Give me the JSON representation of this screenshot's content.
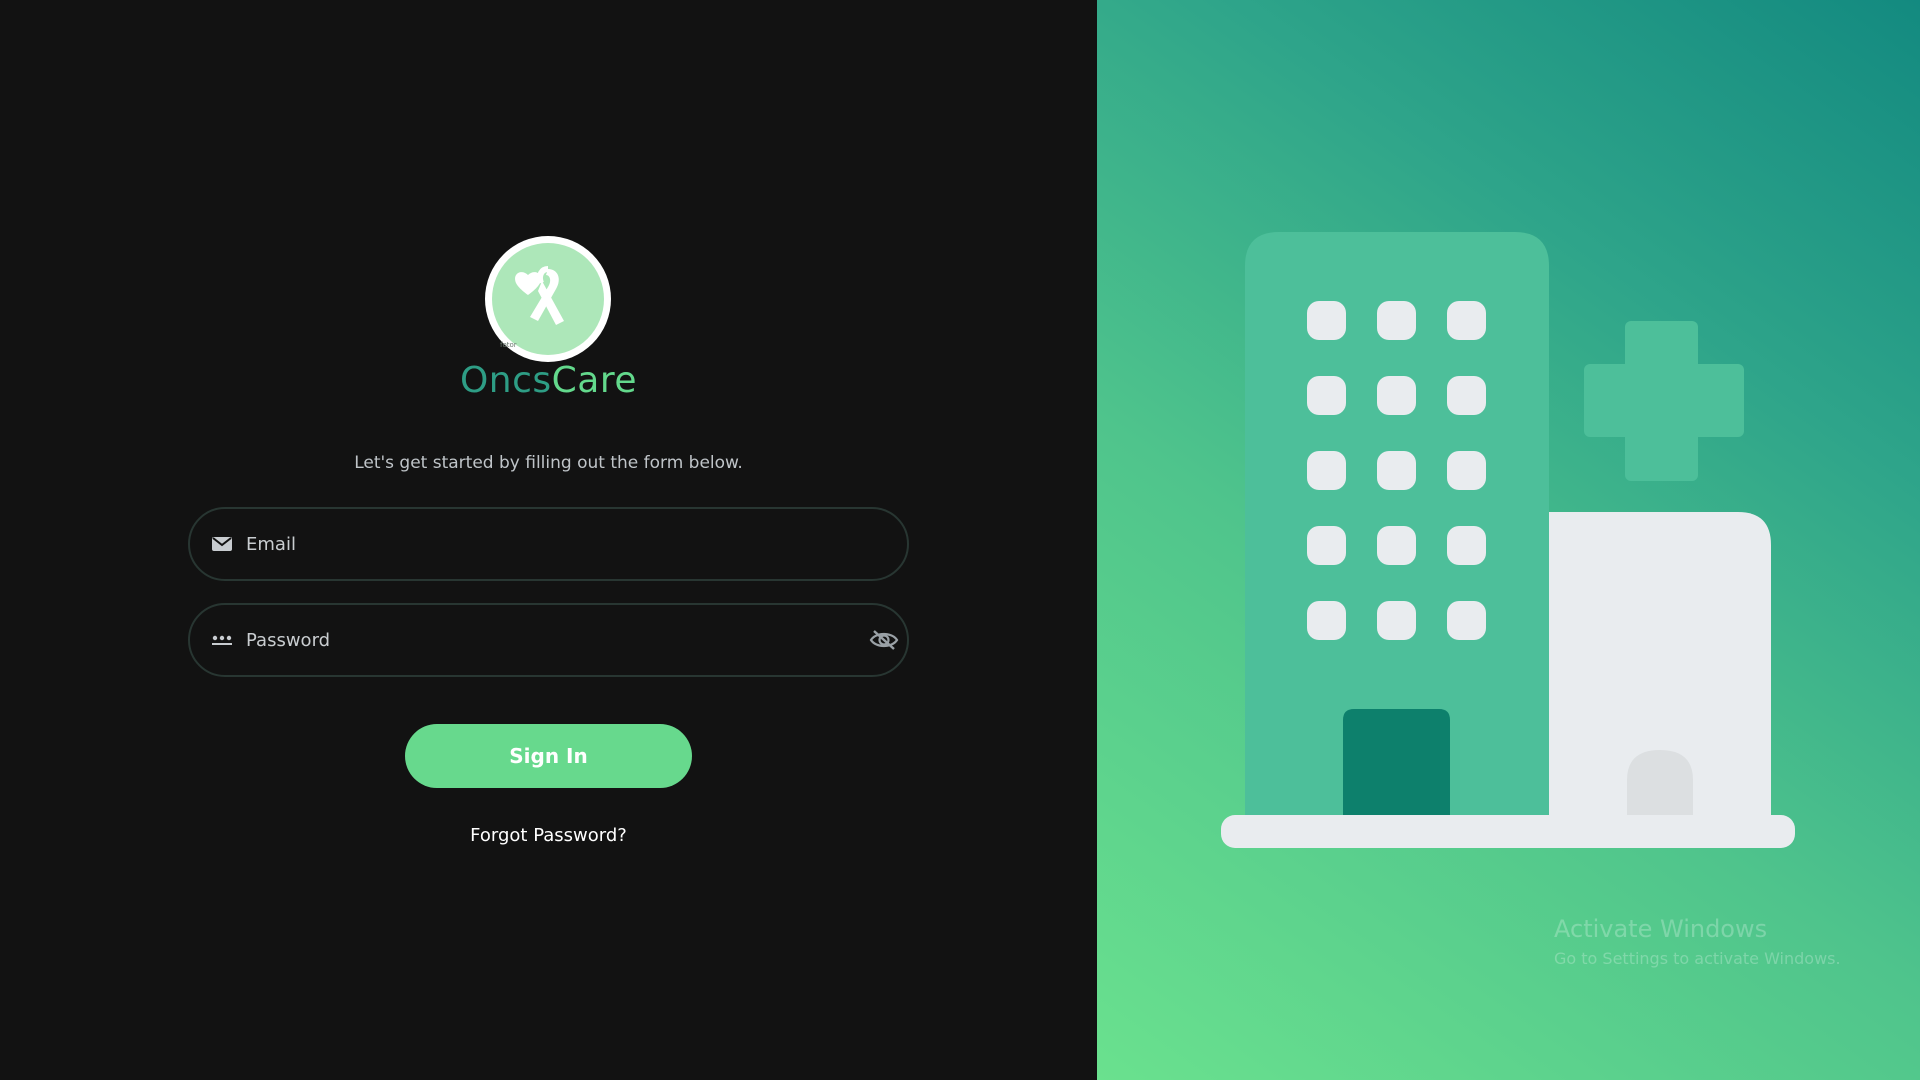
{
  "brand": {
    "logo_tag": "fotor",
    "name_part1": "Oncs",
    "name_part2": "Care"
  },
  "form": {
    "tagline": "Let's get started by filling out the form below.",
    "email_placeholder": "Email",
    "password_placeholder": "Password",
    "signin_label": "Sign In",
    "forgot_label": "Forgot Password?"
  },
  "icons": {
    "email": "mail-icon",
    "password": "password-dots-icon",
    "visibility": "eye-off-icon"
  },
  "colors": {
    "panel_dark": "#121212",
    "accent_green": "#67d98d",
    "brand_teal": "#2e9d85"
  },
  "watermark": {
    "title": "Activate Windows",
    "subtitle": "Go to Settings to activate Windows."
  }
}
